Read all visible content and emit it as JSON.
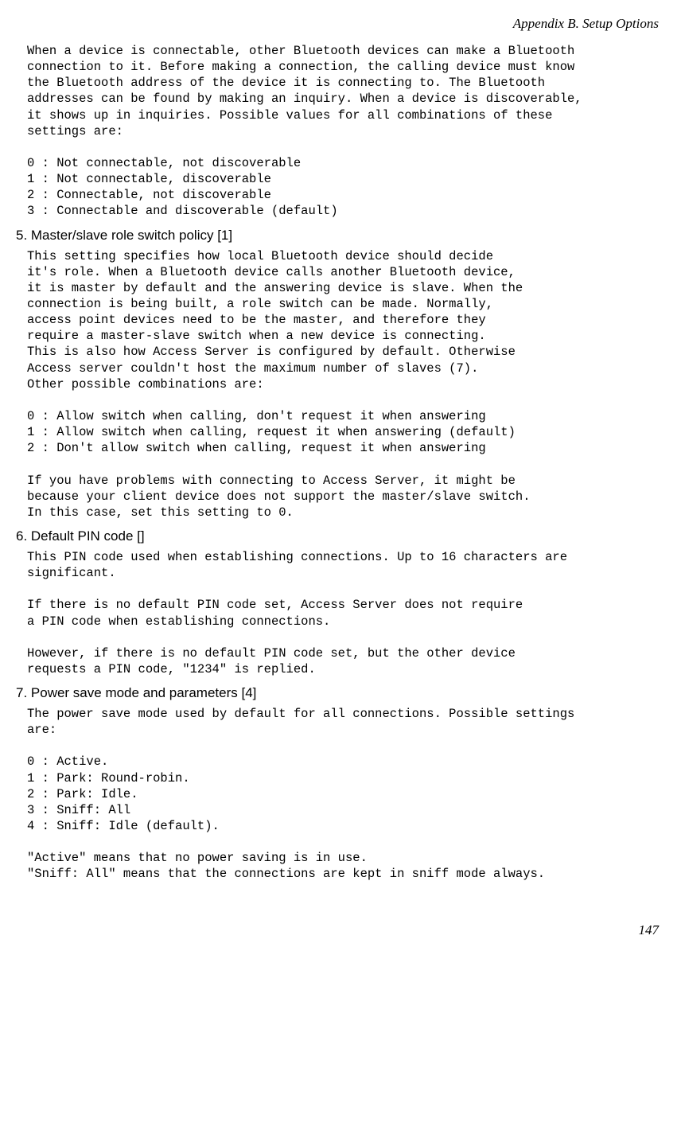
{
  "running_header": "Appendix B. Setup Options",
  "block1": "When a device is connectable, other Bluetooth devices can make a Bluetooth\nconnection to it. Before making a connection, the calling device must know\nthe Bluetooth address of the device it is connecting to. The Bluetooth\naddresses can be found by making an inquiry. When a device is discoverable,\nit shows up in inquiries. Possible values for all combinations of these\nsettings are:\n\n0 : Not connectable, not discoverable\n1 : Not connectable, discoverable\n2 : Connectable, not discoverable\n3 : Connectable and discoverable (default)",
  "heading5": "5. Master/slave role switch policy [1]",
  "block2": "This setting specifies how local Bluetooth device should decide\nit's role. When a Bluetooth device calls another Bluetooth device,\nit is master by default and the answering device is slave. When the\nconnection is being built, a role switch can be made. Normally,\naccess point devices need to be the master, and therefore they\nrequire a master-slave switch when a new device is connecting.\nThis is also how Access Server is configured by default. Otherwise\nAccess server couldn't host the maximum number of slaves (7).\nOther possible combinations are:\n\n0 : Allow switch when calling, don't request it when answering\n1 : Allow switch when calling, request it when answering (default)\n2 : Don't allow switch when calling, request it when answering\n\nIf you have problems with connecting to Access Server, it might be\nbecause your client device does not support the master/slave switch.\nIn this case, set this setting to 0.",
  "heading6": "6. Default PIN code []",
  "block3": "This PIN code used when establishing connections. Up to 16 characters are\nsignificant.\n\nIf there is no default PIN code set, Access Server does not require\na PIN code when establishing connections.\n\nHowever, if there is no default PIN code set, but the other device\nrequests a PIN code, \"1234\" is replied.",
  "heading7": "7. Power save mode and parameters [4]",
  "block4": "The power save mode used by default for all connections. Possible settings\nare:\n\n0 : Active.\n1 : Park: Round-robin.\n2 : Park: Idle.\n3 : Sniff: All\n4 : Sniff: Idle (default).\n\n\"Active\" means that no power saving is in use.\n\"Sniff: All\" means that the connections are kept in sniff mode always.",
  "page_number": "147"
}
